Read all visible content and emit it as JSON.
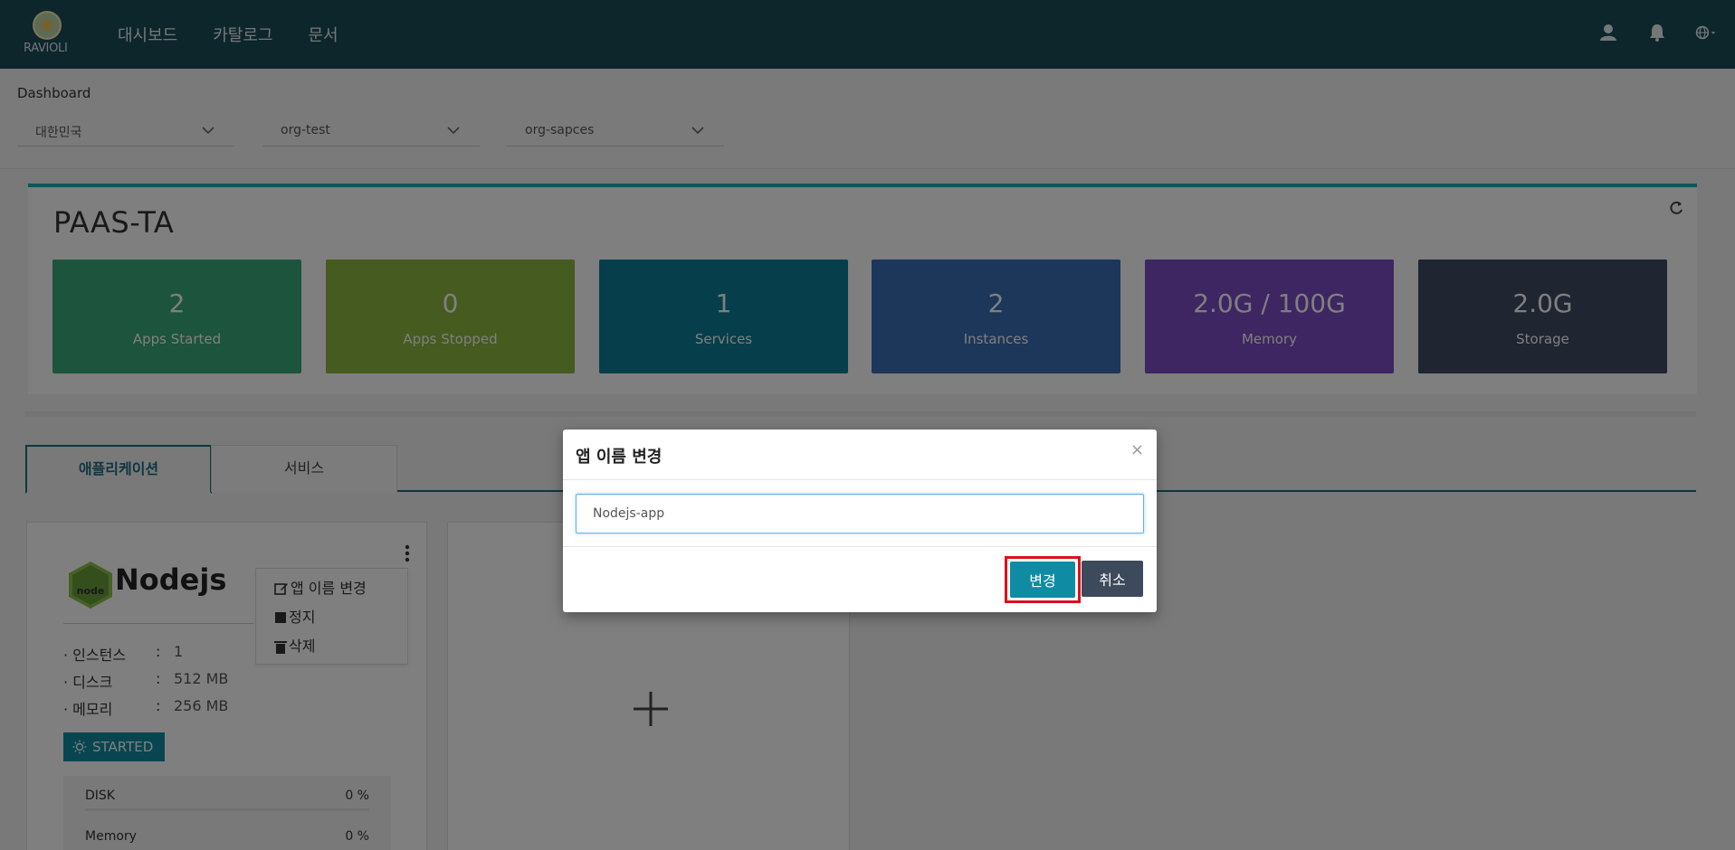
{
  "app": {
    "logo_text": "RAVIOLI"
  },
  "nav": {
    "items": [
      "대시보드",
      "카탈로그",
      "문서"
    ]
  },
  "header_icons": [
    "user-icon",
    "bell-icon",
    "globe-icon"
  ],
  "page": {
    "label": "Dashboard"
  },
  "filters": {
    "region": "대한민국",
    "org": "org-test",
    "space": "org-sapces"
  },
  "summary": {
    "title": "PAAS-TA",
    "stats": [
      {
        "value": "2",
        "label": "Apps Started",
        "color": "#3aa97b"
      },
      {
        "value": "0",
        "label": "Apps Stopped",
        "color": "#8cb63f"
      },
      {
        "value": "1",
        "label": "Services",
        "color": "#0d7f97"
      },
      {
        "value": "2",
        "label": "Instances",
        "color": "#3a6fb4"
      },
      {
        "value": "2.0G / 100G",
        "label": "Memory",
        "color": "#7b4cc2"
      },
      {
        "value": "2.0G",
        "label": "Storage",
        "color": "#3f4a63"
      }
    ]
  },
  "tabs": [
    {
      "label": "애플리케이션",
      "active": true
    },
    {
      "label": "서비스",
      "active": false
    }
  ],
  "app_card": {
    "name": "Nodejs",
    "menu": [
      "앱 이름 변경",
      "정지",
      "삭제"
    ],
    "specs": [
      {
        "key": "· 인스턴스",
        "value": "1"
      },
      {
        "key": "· 디스크",
        "value": "512 MB"
      },
      {
        "key": "· 메모리",
        "value": "256 MB"
      }
    ],
    "status": "STARTED",
    "usage": [
      {
        "label": "DISK",
        "value": "0 %"
      },
      {
        "label": "Memory",
        "value": "0 %"
      }
    ]
  },
  "modal": {
    "title": "앱 이름 변경",
    "close": "×",
    "input_value": "Nodejs-app",
    "confirm_label": "변경",
    "cancel_label": "취소"
  }
}
